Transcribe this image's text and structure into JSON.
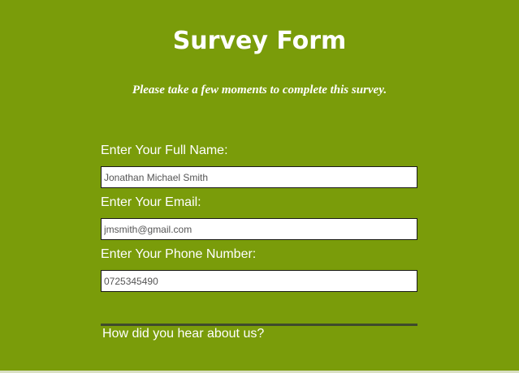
{
  "header": {
    "title": "Survey Form",
    "subtitle": "Please take a few moments to complete this survey."
  },
  "form": {
    "fields": [
      {
        "label": "Enter Your Full Name:",
        "value": "Jonathan Michael Smith"
      },
      {
        "label": "Enter Your Email:",
        "value": "jmsmith@gmail.com"
      },
      {
        "label": "Enter Your Phone Number:",
        "value": "0725345490"
      }
    ],
    "question": "How did you hear about us?"
  },
  "colors": {
    "background": "#7a9c0a",
    "text": "#ffffff",
    "divider": "#3f4a2c"
  }
}
